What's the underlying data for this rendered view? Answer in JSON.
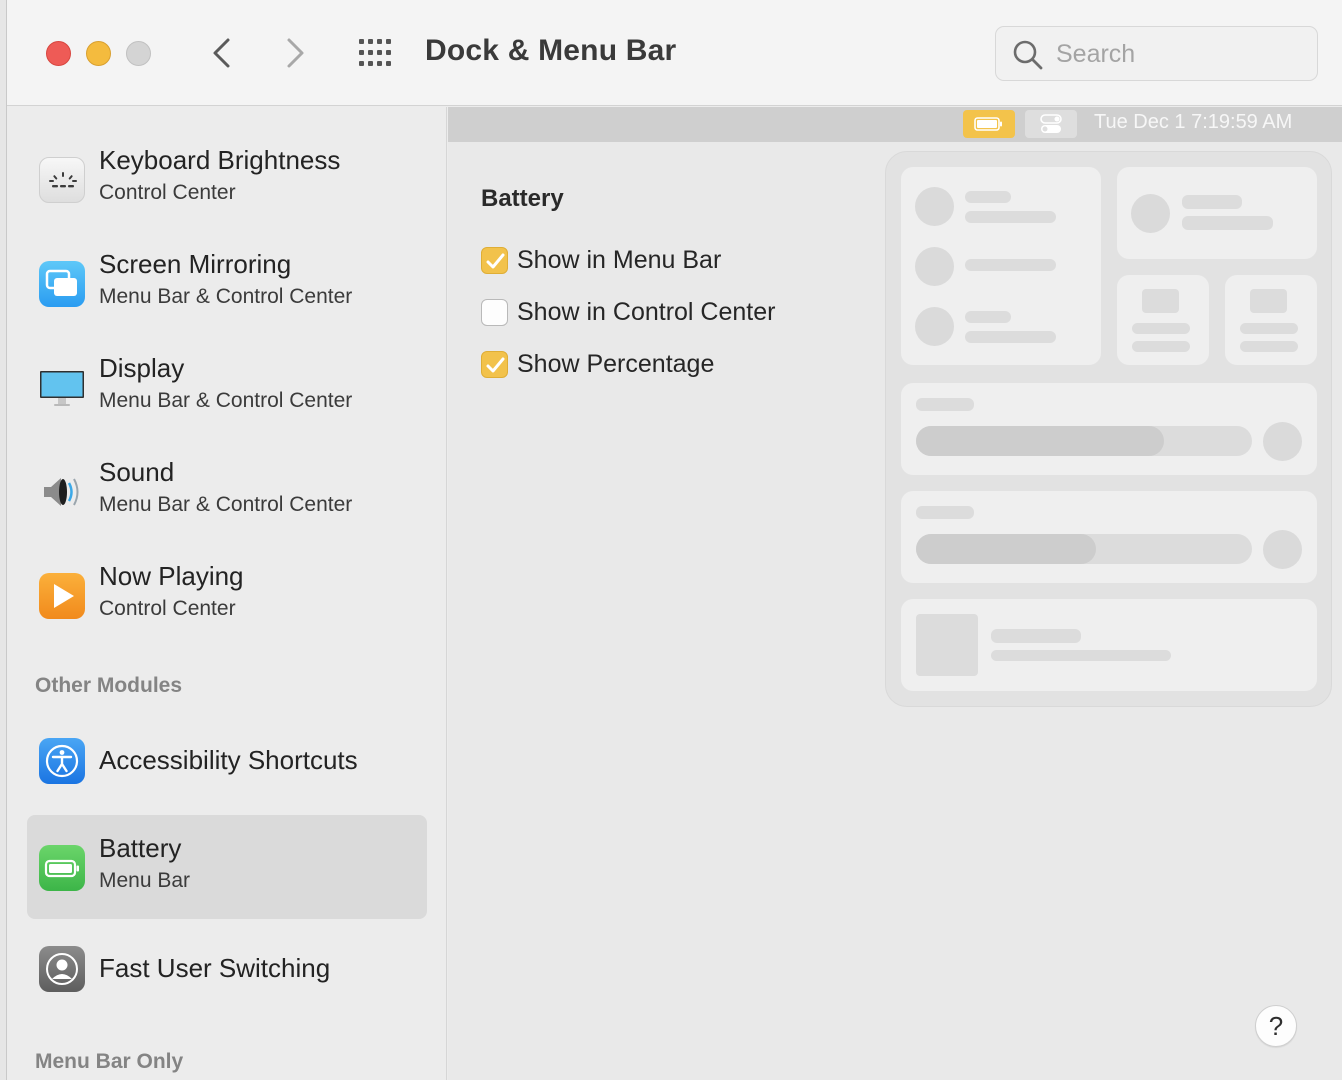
{
  "window": {
    "title": "Dock & Menu Bar",
    "search_placeholder": "Search"
  },
  "menubar_preview": {
    "clock": "Tue Dec 1  7:19:59 AM",
    "icons": [
      "battery-icon",
      "control-center-icon"
    ]
  },
  "sidebar": {
    "items": [
      {
        "title": "Keyboard Brightness",
        "subtitle": "Control Center",
        "icon": "keyboard-brightness-icon"
      },
      {
        "title": "Screen Mirroring",
        "subtitle": "Menu Bar & Control Center",
        "icon": "screen-mirroring-icon"
      },
      {
        "title": "Display",
        "subtitle": "Menu Bar & Control Center",
        "icon": "display-icon"
      },
      {
        "title": "Sound",
        "subtitle": "Menu Bar & Control Center",
        "icon": "speaker-icon"
      },
      {
        "title": "Now Playing",
        "subtitle": "Control Center",
        "icon": "play-icon"
      }
    ],
    "section_other": "Other Modules",
    "other_items": [
      {
        "title": "Accessibility Shortcuts",
        "icon": "accessibility-icon"
      },
      {
        "title": "Battery",
        "subtitle": "Menu Bar",
        "icon": "battery-icon",
        "selected": true
      },
      {
        "title": "Fast User Switching",
        "icon": "user-icon"
      }
    ],
    "section_menubar_only": "Menu Bar Only"
  },
  "pane": {
    "heading": "Battery",
    "options": [
      {
        "label": "Show in Menu Bar",
        "checked": true
      },
      {
        "label": "Show in Control Center",
        "checked": false
      },
      {
        "label": "Show Percentage",
        "checked": true
      }
    ]
  },
  "help_label": "?",
  "colors": {
    "accent": "#f2c24b",
    "close": "#ee5b56",
    "minimize": "#f4bb3e",
    "zoom_disabled": "#d4d4d4",
    "selected_row": "#dadada"
  }
}
